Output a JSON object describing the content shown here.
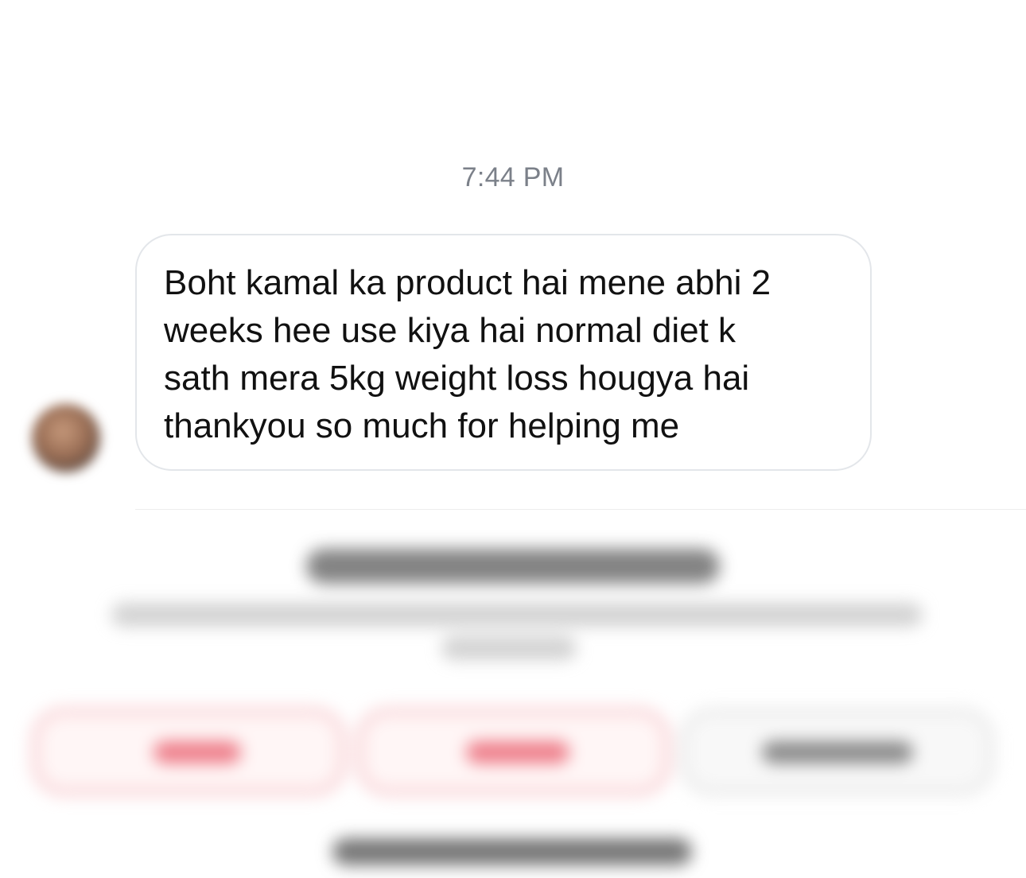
{
  "conversation": {
    "timestamp": "7:44 PM",
    "message": {
      "text": "Boht kamal ka product hai mene abhi 2\nweeks hee use kiya hai normal diet k\nsath mera 5kg weight loss hougya hai\nthankyou so much for helping me"
    }
  },
  "footer": {
    "note": "blurred message request panel with Block, Delete and Accept actions; text unreadable",
    "actions": [
      "block",
      "delete",
      "accept"
    ]
  },
  "colors": {
    "timestamp": "#7b8089",
    "bubble_border": "#e3e6ea",
    "message_text": "#111111",
    "destructive_action": "#ee7e8a"
  }
}
